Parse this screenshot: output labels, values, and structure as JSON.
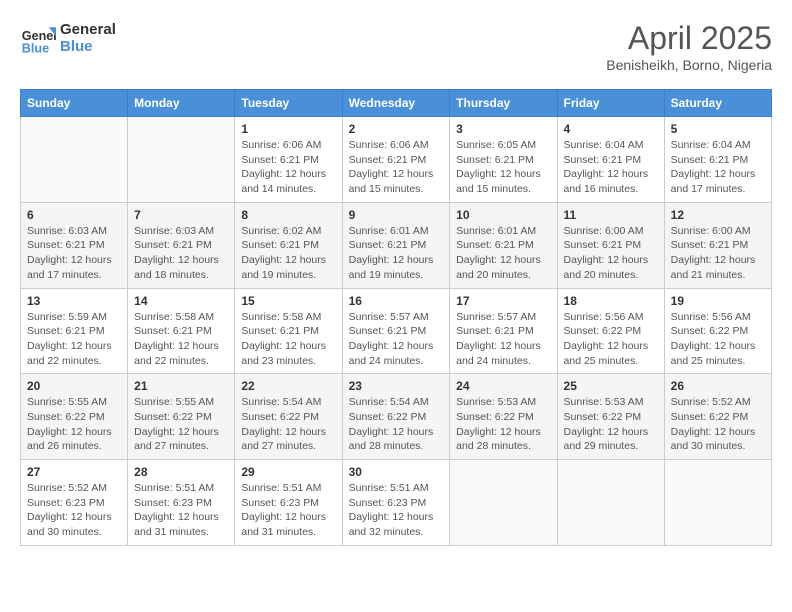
{
  "header": {
    "logo_line1": "General",
    "logo_line2": "Blue",
    "month": "April 2025",
    "location": "Benisheikh, Borno, Nigeria"
  },
  "weekdays": [
    "Sunday",
    "Monday",
    "Tuesday",
    "Wednesday",
    "Thursday",
    "Friday",
    "Saturday"
  ],
  "weeks": [
    [
      {
        "day": "",
        "info": ""
      },
      {
        "day": "",
        "info": ""
      },
      {
        "day": "1",
        "info": "Sunrise: 6:06 AM\nSunset: 6:21 PM\nDaylight: 12 hours and 14 minutes."
      },
      {
        "day": "2",
        "info": "Sunrise: 6:06 AM\nSunset: 6:21 PM\nDaylight: 12 hours and 15 minutes."
      },
      {
        "day": "3",
        "info": "Sunrise: 6:05 AM\nSunset: 6:21 PM\nDaylight: 12 hours and 15 minutes."
      },
      {
        "day": "4",
        "info": "Sunrise: 6:04 AM\nSunset: 6:21 PM\nDaylight: 12 hours and 16 minutes."
      },
      {
        "day": "5",
        "info": "Sunrise: 6:04 AM\nSunset: 6:21 PM\nDaylight: 12 hours and 17 minutes."
      }
    ],
    [
      {
        "day": "6",
        "info": "Sunrise: 6:03 AM\nSunset: 6:21 PM\nDaylight: 12 hours and 17 minutes."
      },
      {
        "day": "7",
        "info": "Sunrise: 6:03 AM\nSunset: 6:21 PM\nDaylight: 12 hours and 18 minutes."
      },
      {
        "day": "8",
        "info": "Sunrise: 6:02 AM\nSunset: 6:21 PM\nDaylight: 12 hours and 19 minutes."
      },
      {
        "day": "9",
        "info": "Sunrise: 6:01 AM\nSunset: 6:21 PM\nDaylight: 12 hours and 19 minutes."
      },
      {
        "day": "10",
        "info": "Sunrise: 6:01 AM\nSunset: 6:21 PM\nDaylight: 12 hours and 20 minutes."
      },
      {
        "day": "11",
        "info": "Sunrise: 6:00 AM\nSunset: 6:21 PM\nDaylight: 12 hours and 20 minutes."
      },
      {
        "day": "12",
        "info": "Sunrise: 6:00 AM\nSunset: 6:21 PM\nDaylight: 12 hours and 21 minutes."
      }
    ],
    [
      {
        "day": "13",
        "info": "Sunrise: 5:59 AM\nSunset: 6:21 PM\nDaylight: 12 hours and 22 minutes."
      },
      {
        "day": "14",
        "info": "Sunrise: 5:58 AM\nSunset: 6:21 PM\nDaylight: 12 hours and 22 minutes."
      },
      {
        "day": "15",
        "info": "Sunrise: 5:58 AM\nSunset: 6:21 PM\nDaylight: 12 hours and 23 minutes."
      },
      {
        "day": "16",
        "info": "Sunrise: 5:57 AM\nSunset: 6:21 PM\nDaylight: 12 hours and 24 minutes."
      },
      {
        "day": "17",
        "info": "Sunrise: 5:57 AM\nSunset: 6:21 PM\nDaylight: 12 hours and 24 minutes."
      },
      {
        "day": "18",
        "info": "Sunrise: 5:56 AM\nSunset: 6:22 PM\nDaylight: 12 hours and 25 minutes."
      },
      {
        "day": "19",
        "info": "Sunrise: 5:56 AM\nSunset: 6:22 PM\nDaylight: 12 hours and 25 minutes."
      }
    ],
    [
      {
        "day": "20",
        "info": "Sunrise: 5:55 AM\nSunset: 6:22 PM\nDaylight: 12 hours and 26 minutes."
      },
      {
        "day": "21",
        "info": "Sunrise: 5:55 AM\nSunset: 6:22 PM\nDaylight: 12 hours and 27 minutes."
      },
      {
        "day": "22",
        "info": "Sunrise: 5:54 AM\nSunset: 6:22 PM\nDaylight: 12 hours and 27 minutes."
      },
      {
        "day": "23",
        "info": "Sunrise: 5:54 AM\nSunset: 6:22 PM\nDaylight: 12 hours and 28 minutes."
      },
      {
        "day": "24",
        "info": "Sunrise: 5:53 AM\nSunset: 6:22 PM\nDaylight: 12 hours and 28 minutes."
      },
      {
        "day": "25",
        "info": "Sunrise: 5:53 AM\nSunset: 6:22 PM\nDaylight: 12 hours and 29 minutes."
      },
      {
        "day": "26",
        "info": "Sunrise: 5:52 AM\nSunset: 6:22 PM\nDaylight: 12 hours and 30 minutes."
      }
    ],
    [
      {
        "day": "27",
        "info": "Sunrise: 5:52 AM\nSunset: 6:23 PM\nDaylight: 12 hours and 30 minutes."
      },
      {
        "day": "28",
        "info": "Sunrise: 5:51 AM\nSunset: 6:23 PM\nDaylight: 12 hours and 31 minutes."
      },
      {
        "day": "29",
        "info": "Sunrise: 5:51 AM\nSunset: 6:23 PM\nDaylight: 12 hours and 31 minutes."
      },
      {
        "day": "30",
        "info": "Sunrise: 5:51 AM\nSunset: 6:23 PM\nDaylight: 12 hours and 32 minutes."
      },
      {
        "day": "",
        "info": ""
      },
      {
        "day": "",
        "info": ""
      },
      {
        "day": "",
        "info": ""
      }
    ]
  ]
}
